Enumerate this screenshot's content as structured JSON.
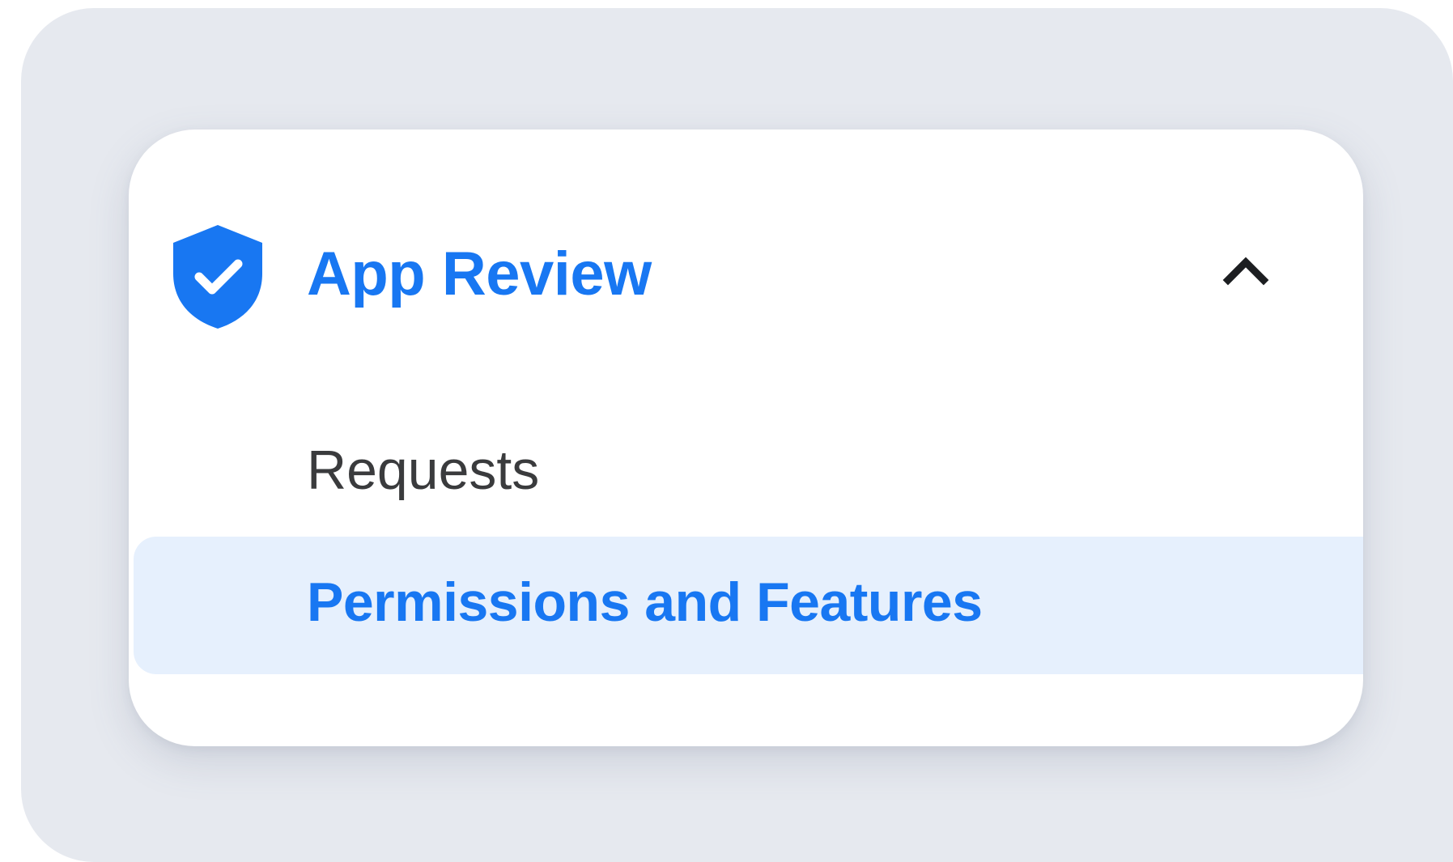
{
  "nav": {
    "section_title": "App Review",
    "section_icon": "shield-check-icon",
    "expand_icon": "chevron-up-icon",
    "items": [
      {
        "label": "Requests",
        "active": false
      },
      {
        "label": "Permissions and Features",
        "active": true
      }
    ]
  },
  "colors": {
    "accent": "#1877f2",
    "active_bg": "#e6f0fd",
    "text": "#3a3b3d",
    "backdrop": "#e6e9ef"
  }
}
